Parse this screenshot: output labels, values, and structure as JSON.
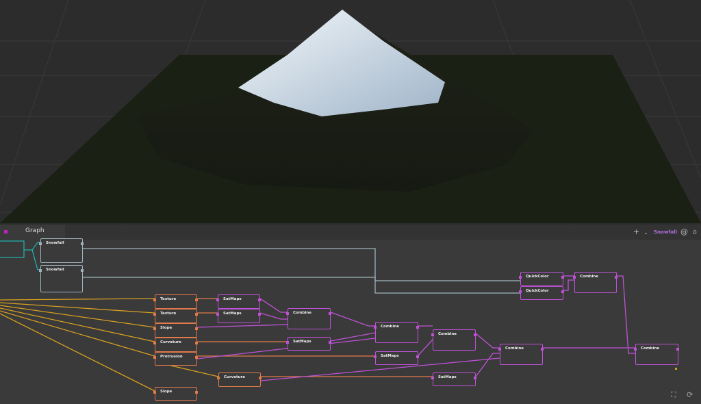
{
  "graph_panel": {
    "tab_label": "Graph",
    "toolbar": {
      "add_icon": "plus-icon",
      "dropdown_icon": "chevron-down-icon",
      "active_node": "Snowfall",
      "at_icon": "at-icon",
      "home_icon": "home-icon"
    },
    "nodes": [
      {
        "id": "n1",
        "label": "Snowfall",
        "kind": "w"
      },
      {
        "id": "n2",
        "label": "Snowfall",
        "kind": "w"
      },
      {
        "id": "n3",
        "label": "Texture",
        "kind": "o"
      },
      {
        "id": "n4",
        "label": "Texture",
        "kind": "o"
      },
      {
        "id": "n5",
        "label": "Slope",
        "kind": "o"
      },
      {
        "id": "n6",
        "label": "Curvature",
        "kind": "o"
      },
      {
        "id": "n7",
        "label": "Protrusion",
        "kind": "o"
      },
      {
        "id": "n8",
        "label": "Curvature",
        "kind": "o"
      },
      {
        "id": "n9",
        "label": "Slope",
        "kind": "o"
      },
      {
        "id": "n10",
        "label": "SatMaps",
        "kind": "p"
      },
      {
        "id": "n11",
        "label": "SatMaps",
        "kind": "p"
      },
      {
        "id": "n12",
        "label": "Combine",
        "kind": "p"
      },
      {
        "id": "n13",
        "label": "SatMaps",
        "kind": "p"
      },
      {
        "id": "n14",
        "label": "Combine",
        "kind": "p"
      },
      {
        "id": "n15",
        "label": "SatMaps",
        "kind": "p"
      },
      {
        "id": "n16",
        "label": "Combine",
        "kind": "p"
      },
      {
        "id": "n17",
        "label": "SatMaps",
        "kind": "p"
      },
      {
        "id": "n18",
        "label": "Combine",
        "kind": "p"
      },
      {
        "id": "n19",
        "label": "QuickColor",
        "kind": "p"
      },
      {
        "id": "n20",
        "label": "QuickColor",
        "kind": "p"
      },
      {
        "id": "n21",
        "label": "Combine",
        "kind": "p"
      },
      {
        "id": "n22",
        "label": "Combine",
        "kind": "p"
      }
    ],
    "bottom_icons": [
      "frame-icon",
      "refresh-icon"
    ]
  },
  "colors": {
    "orange": "#e07a4a",
    "purple": "#c052d8",
    "grey": "#9fb3bb",
    "teal": "#20b0b0",
    "yellow": "#d8a020"
  }
}
